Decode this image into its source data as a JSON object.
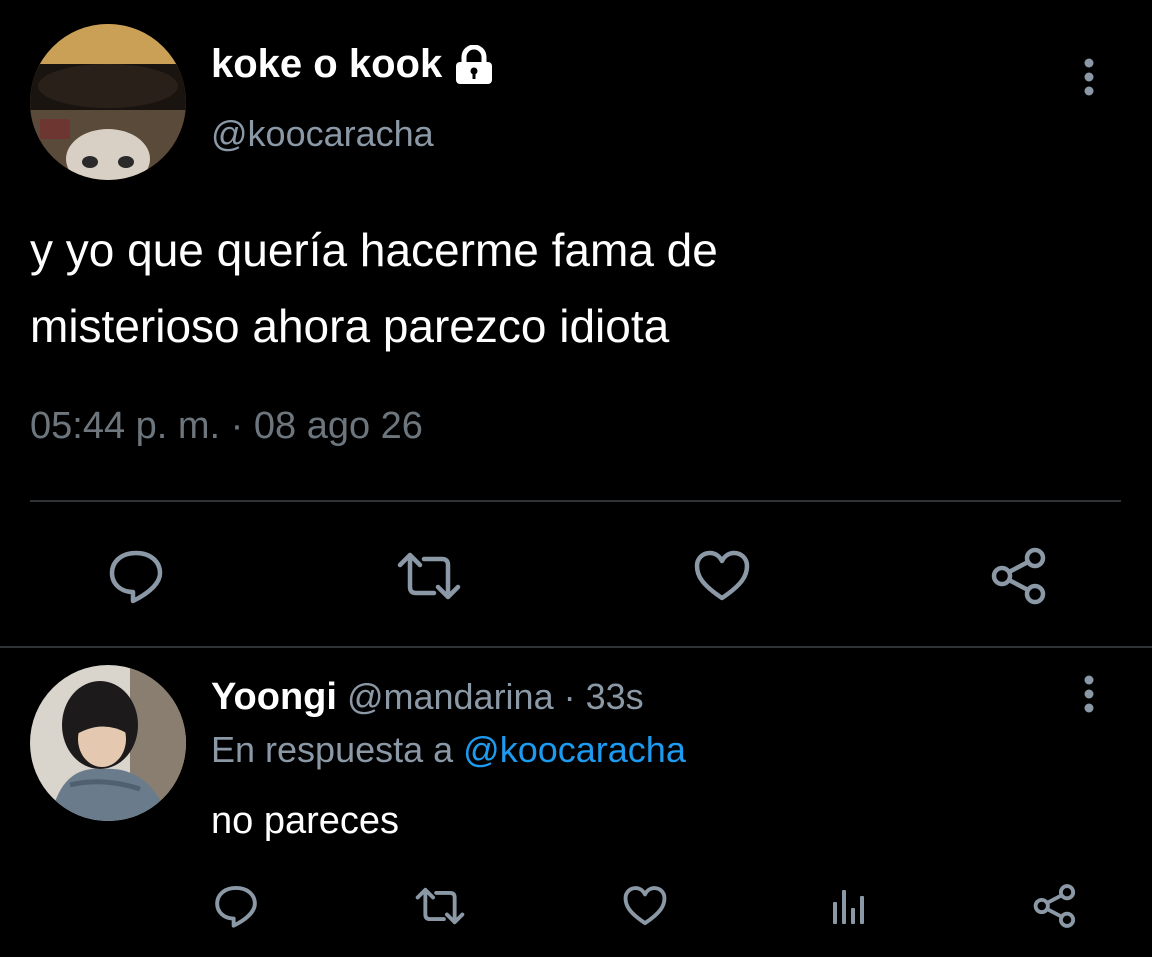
{
  "tweet": {
    "display_name": "koke o kook",
    "handle": "@koocaracha",
    "text_line1": "y yo que quería hacerme fama de",
    "text_line2": "misterioso ahora parezco idiota",
    "timestamp": "05:44 p. m. · 08 ago 26",
    "avatar_icon": "avatar-cat-photo",
    "lock_icon": "lock-icon",
    "actions": [
      "reply-icon",
      "retweet-icon",
      "like-icon",
      "share-icon"
    ]
  },
  "reply": {
    "display_name": "Yoongi",
    "handle": "@mandarina",
    "time": "· 33s",
    "reply_prefix": "En respuesta a",
    "reply_mention": "@koocaracha",
    "text": "no pareces",
    "avatar_icon": "avatar-person-photo",
    "actions": [
      "reply-icon",
      "retweet-icon",
      "like-icon",
      "analytics-icon",
      "share-icon"
    ]
  },
  "colors": {
    "background": "#000000",
    "text": "#ffffff",
    "secondary": "#8b98a5",
    "timestamp": "#6e767d",
    "accent": "#1d9bf0",
    "divider": "#2f3336"
  }
}
